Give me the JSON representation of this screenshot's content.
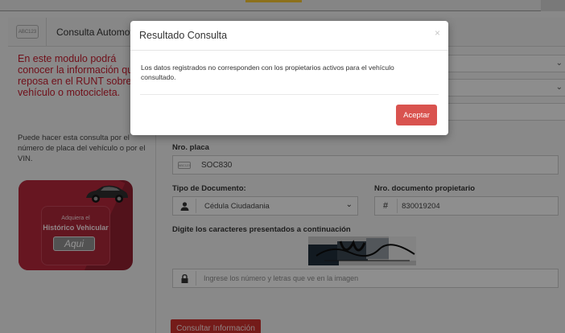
{
  "header": {
    "badge": "ABC123",
    "title": "Consulta Automotores"
  },
  "sidebar": {
    "intro": "En este modulo podrá conocer la información que reposa en el RUNT sobre su vehículo o motocicleta.",
    "help": "Puede hacer esta consulta por el número de placa del vehículo o por el VIN.",
    "promo": {
      "line1": "Adquiera el",
      "line2": "Histórico Vehicular",
      "button": "Aqui"
    }
  },
  "form": {
    "placa_label": "Nro. placa",
    "placa_badge": "ABC123",
    "placa_value": "SOC830",
    "tipo_doc_label": "Tipo de Documento:",
    "tipo_doc_value": "Cédula Ciudadania",
    "nro_doc_label": "Nro. documento propietario",
    "nro_doc_value": "830019204",
    "captcha_label": "Digite los caracteres presentados a continuación",
    "captcha_placeholder": "Ingrese los número y letras que ve en la imagen",
    "submit": "Consultar Información"
  },
  "modal": {
    "title": "Resultado Consulta",
    "close": "×",
    "message": "Los datos registrados no corresponden con los propietarios activos para el vehículo consultado.",
    "accept": "Aceptar"
  },
  "colors": {
    "accent_red": "#c21d2e",
    "button_red": "#d9534f"
  }
}
